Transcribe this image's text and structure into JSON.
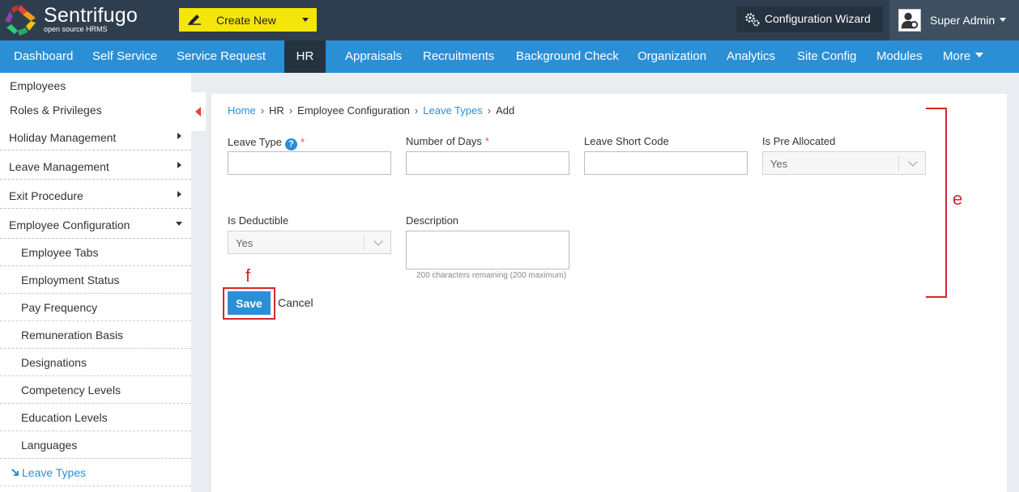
{
  "topbar": {
    "brand_name": "Sentrifugo",
    "brand_sub": "open source HRMS",
    "create_new": "Create New",
    "configuration_wizard": "Configuration Wizard",
    "user_name": "Super Admin"
  },
  "nav": {
    "items": [
      "Dashboard",
      "Self Service",
      "Service Request",
      "HR",
      "Appraisals",
      "Recruitments",
      "Background Check",
      "Organization",
      "Analytics",
      "Site Config",
      "Modules",
      "More"
    ],
    "active": "HR"
  },
  "sidebar": {
    "items": [
      {
        "label": "Employees"
      },
      {
        "label": "Roles & Privileges"
      },
      {
        "label": "Holiday Management"
      },
      {
        "label": "Leave Management"
      },
      {
        "label": "Exit Procedure"
      },
      {
        "label": "Employee Configuration"
      }
    ],
    "sub_items": [
      "Employee Tabs",
      "Employment Status",
      "Pay Frequency",
      "Remuneration Basis",
      "Designations",
      "Competency Levels",
      "Education Levels",
      "Languages",
      "Leave Types"
    ],
    "active_sub": "Leave Types"
  },
  "breadcrumb": [
    "Home",
    "HR",
    "Employee Configuration",
    "Leave Types",
    "Add"
  ],
  "form": {
    "leave_type_label": "Leave Type",
    "leave_type_value": "",
    "number_of_days_label": "Number of Days",
    "number_of_days_value": "",
    "leave_short_code_label": "Leave Short Code",
    "leave_short_code_value": "",
    "is_pre_allocated_label": "Is Pre Allocated",
    "is_pre_allocated_value": "Yes",
    "is_deductible_label": "Is Deductible",
    "is_deductible_value": "Yes",
    "description_label": "Description",
    "description_value": "",
    "description_hint": "200 characters remaining (200 maximum)",
    "required_mark": "*",
    "help_glyph": "?"
  },
  "actions": {
    "save": "Save",
    "cancel": "Cancel"
  },
  "annotations": {
    "e": "e",
    "f": "f"
  },
  "colors": {
    "topbar": "#2f3e4f",
    "nav": "#2b8fd6",
    "create_new": "#f5e60a",
    "annotation": "#d7262c"
  }
}
